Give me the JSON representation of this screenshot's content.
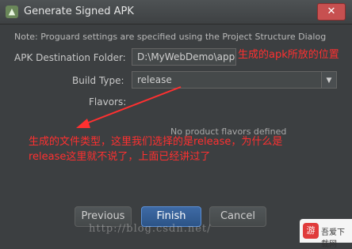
{
  "window": {
    "title": "Generate Signed APK",
    "close_label": "✕"
  },
  "note": "Note: Proguard settings are specified using the Project Structure Dialog",
  "form": {
    "destination_label": "APK Destination Folder:",
    "destination_value": "D:\\MyWebDemo\\app",
    "build_type_label": "Build Type:",
    "build_type_value": "release",
    "flavors_label": "Flavors:",
    "no_flavors_text": "No product flavors defined"
  },
  "annotations": {
    "folder_note": "生成的apk所放的位置",
    "type_note_line1": "生成的文件类型，这里我们选择的是release，为什么是",
    "type_note_line2": "release这里就不说了，上面已经讲过了"
  },
  "buttons": {
    "previous": "Previous",
    "finish": "Finish",
    "cancel": "Cancel"
  },
  "watermark": "http://blog.csdn.net/",
  "logo": {
    "mark": "游",
    "text": "吾爱下载网"
  },
  "colors": {
    "background": "#3c3f41",
    "annotation": "#ff3030",
    "primary_button": "#3e6aa5"
  }
}
